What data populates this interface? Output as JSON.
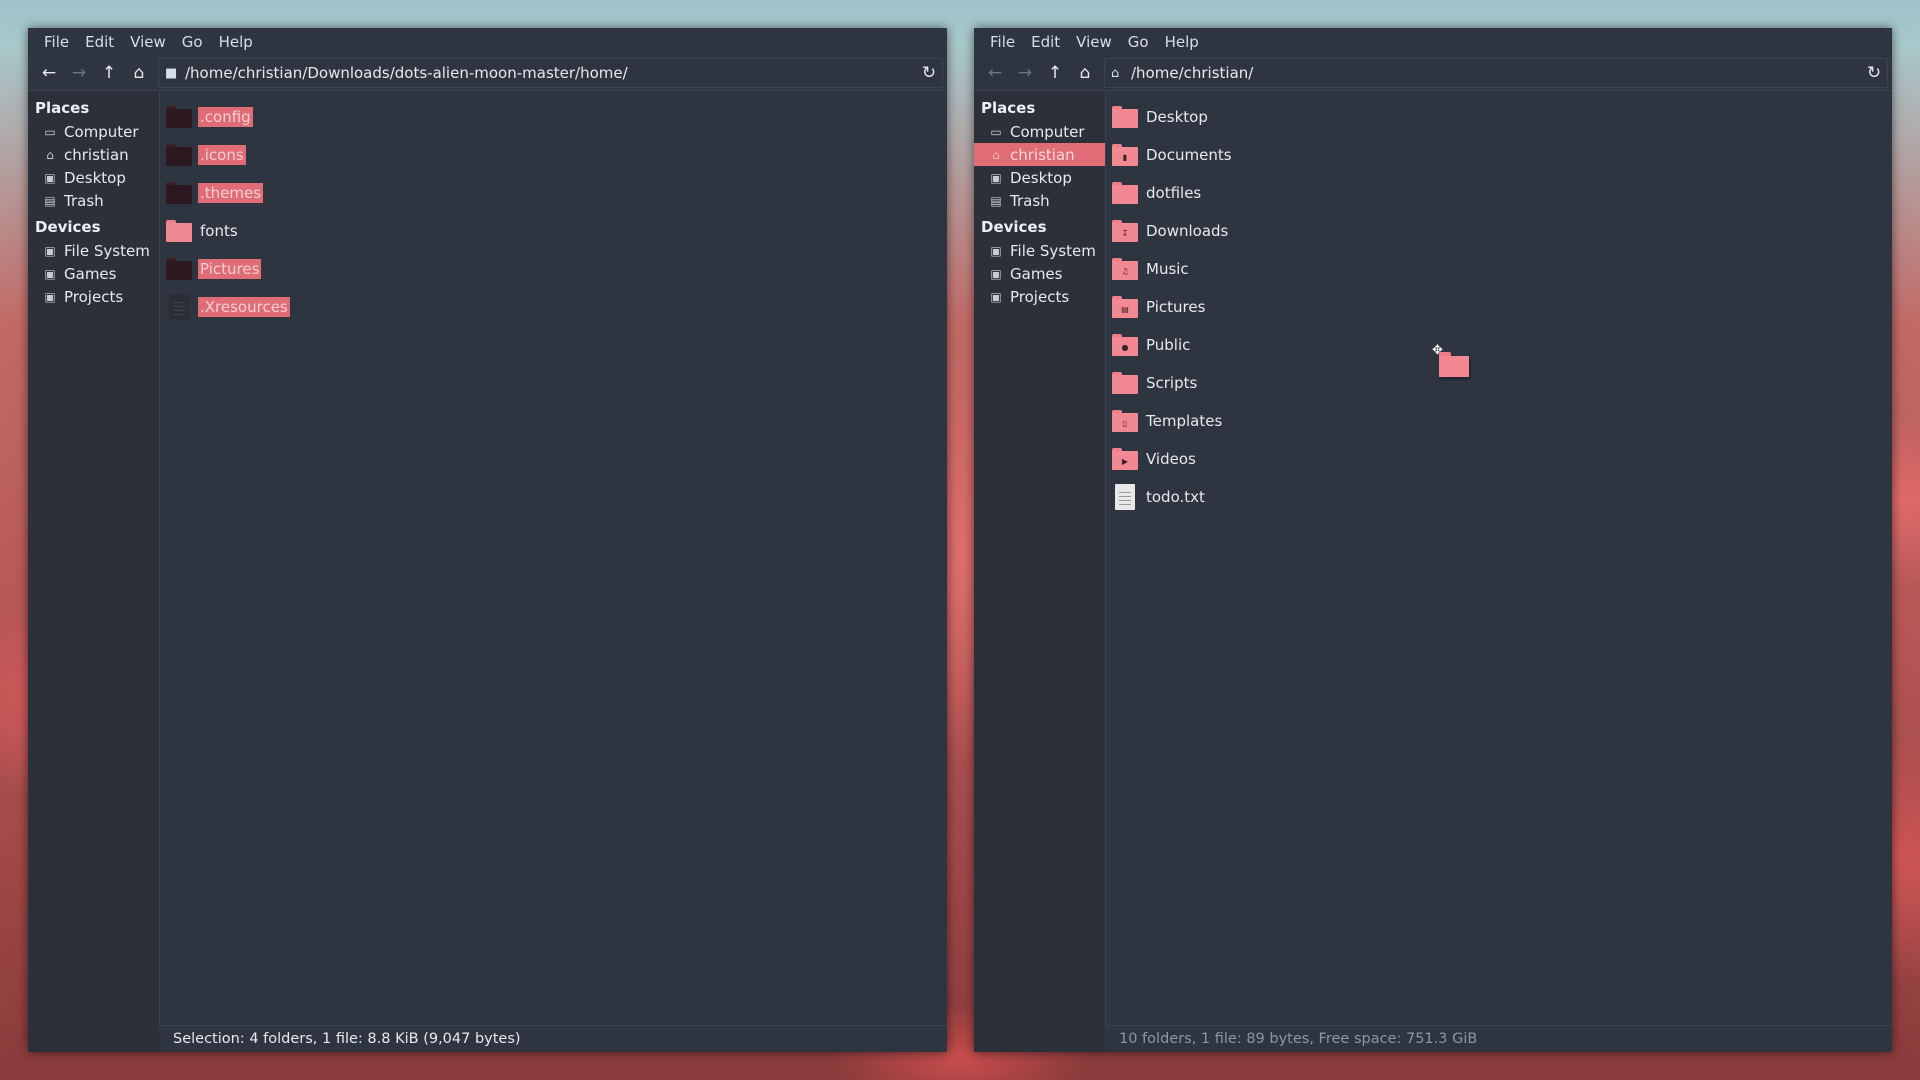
{
  "left_window": {
    "menu": [
      "File",
      "Edit",
      "View",
      "Go",
      "Help"
    ],
    "path": "/home/christian/Downloads/dots-alien-moon-master/home/",
    "path_icon": "folder-icon",
    "sidebar": {
      "places_header": "Places",
      "places": [
        {
          "label": "Computer",
          "icon": "computer-icon"
        },
        {
          "label": "christian",
          "icon": "home-icon"
        },
        {
          "label": "Desktop",
          "icon": "desktop-icon"
        },
        {
          "label": "Trash",
          "icon": "trash-icon"
        }
      ],
      "devices_header": "Devices",
      "devices": [
        {
          "label": "File System",
          "icon": "drive-icon"
        },
        {
          "label": "Games",
          "icon": "drive-icon"
        },
        {
          "label": "Projects",
          "icon": "drive-icon"
        }
      ]
    },
    "files": [
      {
        "name": ".config",
        "type": "folder",
        "selected": true
      },
      {
        "name": ".icons",
        "type": "folder",
        "selected": true
      },
      {
        "name": ".themes",
        "type": "folder",
        "selected": true
      },
      {
        "name": "fonts",
        "type": "folder",
        "selected": false
      },
      {
        "name": "Pictures",
        "type": "folder",
        "selected": true
      },
      {
        "name": ".Xresources",
        "type": "file",
        "selected": true
      }
    ],
    "status": "Selection: 4 folders, 1 file: 8.8 KiB (9,047 bytes)"
  },
  "right_window": {
    "menu": [
      "File",
      "Edit",
      "View",
      "Go",
      "Help"
    ],
    "path": "/home/christian/",
    "path_icon": "home-icon",
    "sidebar": {
      "places_header": "Places",
      "places": [
        {
          "label": "Computer",
          "icon": "computer-icon"
        },
        {
          "label": "christian",
          "icon": "home-icon",
          "active": true
        },
        {
          "label": "Desktop",
          "icon": "desktop-icon"
        },
        {
          "label": "Trash",
          "icon": "trash-icon"
        }
      ],
      "devices_header": "Devices",
      "devices": [
        {
          "label": "File System",
          "icon": "drive-icon"
        },
        {
          "label": "Games",
          "icon": "drive-icon"
        },
        {
          "label": "Projects",
          "icon": "drive-icon"
        }
      ]
    },
    "files": [
      {
        "name": "Desktop",
        "type": "folder",
        "emblem": ""
      },
      {
        "name": "Documents",
        "type": "folder",
        "emblem": "document"
      },
      {
        "name": "dotfiles",
        "type": "folder",
        "emblem": ""
      },
      {
        "name": "Downloads",
        "type": "folder",
        "emblem": "download"
      },
      {
        "name": "Music",
        "type": "folder",
        "emblem": "music"
      },
      {
        "name": "Pictures",
        "type": "folder",
        "emblem": "picture"
      },
      {
        "name": "Public",
        "type": "folder",
        "emblem": "person"
      },
      {
        "name": "Scripts",
        "type": "folder",
        "emblem": ""
      },
      {
        "name": "Templates",
        "type": "folder",
        "emblem": "template"
      },
      {
        "name": "Videos",
        "type": "folder",
        "emblem": "video"
      },
      {
        "name": "todo.txt",
        "type": "file"
      }
    ],
    "status": "10 folders, 1 file: 89 bytes, Free space: 751.3 GiB"
  },
  "drag": {
    "icon": "folder-icon"
  },
  "colors": {
    "window_bg": "#2e3440",
    "sidebar_bg": "#2b303b",
    "accent": "#e06c75",
    "folder_pink": "#f28891",
    "folder_dark": "#2c1820"
  }
}
